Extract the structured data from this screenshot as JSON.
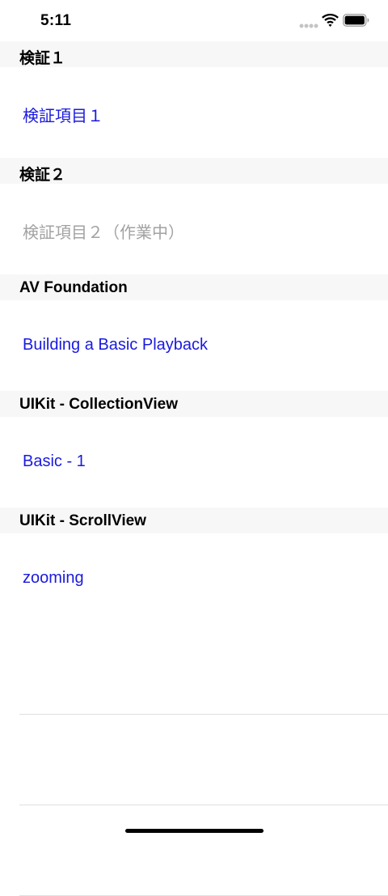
{
  "status_bar": {
    "time": "5:11"
  },
  "sections": [
    {
      "title": "検証１",
      "items": [
        {
          "label": "検証項目１",
          "enabled": true
        }
      ]
    },
    {
      "title": "検証２",
      "items": [
        {
          "label": "検証項目２（作業中）",
          "enabled": false
        }
      ]
    },
    {
      "title": "AV Foundation",
      "items": [
        {
          "label": "Building a Basic Playback",
          "enabled": true
        }
      ]
    },
    {
      "title": "UIKit - CollectionView",
      "items": [
        {
          "label": "Basic - 1",
          "enabled": true
        }
      ]
    },
    {
      "title": "UIKit - ScrollView",
      "items": [
        {
          "label": "zooming",
          "enabled": true
        }
      ]
    }
  ],
  "colors": {
    "link": "#1a1adf",
    "disabled": "#a2a2a2",
    "header_bg": "#f7f7f7",
    "separator": "#e0e0e0"
  },
  "icons": [
    "cellular-signal-icon",
    "wifi-icon",
    "battery-icon"
  ]
}
